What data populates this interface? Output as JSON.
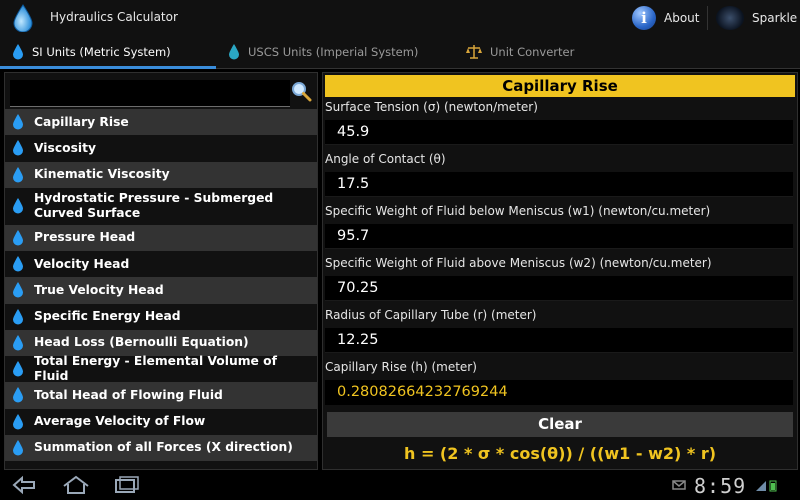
{
  "app": {
    "title": "Hydraulics Calculator"
  },
  "actions": {
    "about_label": "About",
    "sparkle_label": "Sparkle"
  },
  "tabs": [
    {
      "label": "SI Units (Metric System)",
      "active": true
    },
    {
      "label": "USCS Units (Imperial System)",
      "active": false
    },
    {
      "label": "Unit Converter",
      "active": false
    }
  ],
  "search": {
    "value": "",
    "placeholder": ""
  },
  "list": [
    "Capillary Rise",
    "Viscosity",
    "Kinematic Viscosity",
    "Hydrostatic Pressure - Submerged Curved Surface",
    "Pressure Head",
    "Velocity Head",
    "True Velocity Head",
    "Specific Energy Head",
    "Head Loss (Bernoulli Equation)",
    "Total Energy - Elemental Volume of Fluid",
    "Total Head of Flowing Fluid",
    "Average Velocity of Flow",
    "Summation of all Forces (X direction)"
  ],
  "calculator": {
    "title": "Capillary Rise",
    "fields": [
      {
        "label": "Surface Tension (σ) (newton/meter)",
        "value": "45.9"
      },
      {
        "label": "Angle of Contact (θ)",
        "value": "17.5"
      },
      {
        "label": "Specific Weight of Fluid below Meniscus (w1) (newton/cu.meter)",
        "value": "95.7"
      },
      {
        "label": "Specific Weight of Fluid above Meniscus (w2) (newton/cu.meter)",
        "value": "70.25"
      },
      {
        "label": "Radius of Capillary Tube (r) (meter)",
        "value": "12.25"
      }
    ],
    "result_label": "Capillary Rise (h) (meter)",
    "result_value": "0.28082664232769244",
    "clear_label": "Clear",
    "formula": "h = (2 * σ * cos(θ)) / ((w1 - w2) * r)"
  },
  "status": {
    "time": "8:59"
  },
  "colors": {
    "accent": "#f0c420",
    "tab_indicator": "#3a8ddb",
    "drop": "#2a9df4"
  }
}
